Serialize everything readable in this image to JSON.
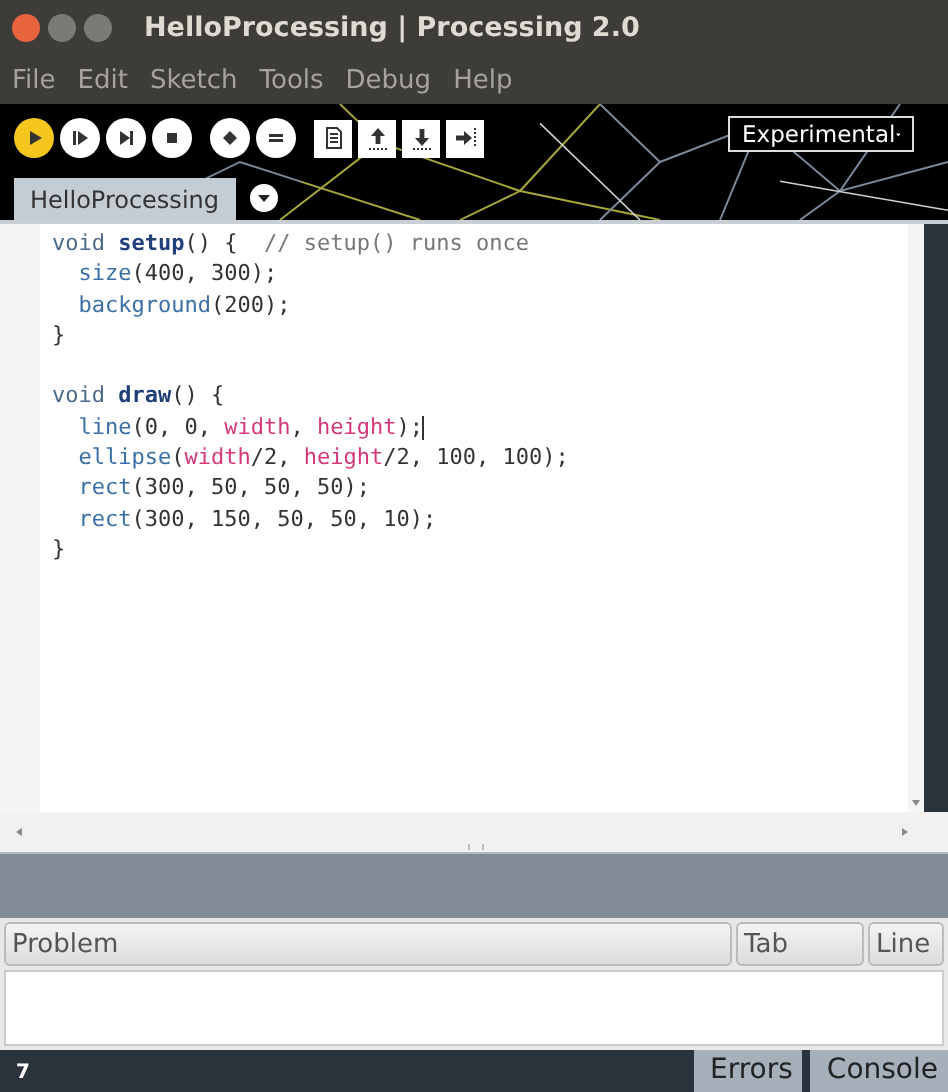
{
  "window": {
    "title": "HelloProcessing | Processing 2.0"
  },
  "menu": [
    "File",
    "Edit",
    "Sketch",
    "Tools",
    "Debug",
    "Help"
  ],
  "toolbar": [
    {
      "kind": "circle",
      "selected": true
    },
    {
      "kind": "circle",
      "selected": false
    },
    {
      "kind": "circle",
      "selected": false
    },
    {
      "kind": "circle",
      "selected": false
    },
    {
      "kind": "circle",
      "selected": false
    },
    {
      "kind": "circle",
      "selected": false
    },
    {
      "kind": "square",
      "selected": false
    },
    {
      "kind": "square",
      "selected": false
    },
    {
      "kind": "square",
      "selected": false
    },
    {
      "kind": "square",
      "selected": false
    }
  ],
  "mode": "Experimental",
  "tabs": [
    {
      "label": "HelloProcessing",
      "selected": true
    }
  ],
  "code": [
    {
      "lines": [
        {
          "cursor": false,
          "segments": [
            {
              "kind": "keyword",
              "t": "void "
            },
            {
              "kind": "function",
              "t": "setup"
            },
            {
              "kind": "plain",
              "t": "() {  "
            },
            {
              "kind": "comment",
              "t": "// setup() runs once"
            }
          ]
        },
        {
          "cursor": false,
          "segments": [
            {
              "kind": "call",
              "t": "  size"
            },
            {
              "kind": "plain",
              "t": "(400, 300);"
            }
          ]
        },
        {
          "cursor": false,
          "segments": [
            {
              "kind": "call",
              "t": "  background"
            },
            {
              "kind": "plain",
              "t": "(200);"
            }
          ]
        },
        {
          "cursor": false,
          "segments": [
            {
              "kind": "plain",
              "t": "}"
            }
          ]
        }
      ]
    },
    {
      "lines": [
        {
          "cursor": false,
          "segments": [
            {
              "kind": "keyword",
              "t": "void "
            },
            {
              "kind": "function",
              "t": "draw"
            },
            {
              "kind": "plain",
              "t": "() {"
            }
          ]
        },
        {
          "cursor": true,
          "segments": [
            {
              "kind": "call",
              "t": "  line"
            },
            {
              "kind": "plain",
              "t": "(0, 0, "
            },
            {
              "kind": "constant",
              "t": "width"
            },
            {
              "kind": "plain",
              "t": ", "
            },
            {
              "kind": "constant",
              "t": "height"
            },
            {
              "kind": "plain",
              "t": ");"
            }
          ]
        },
        {
          "cursor": false,
          "segments": [
            {
              "kind": "call",
              "t": "  ellipse"
            },
            {
              "kind": "plain",
              "t": "("
            },
            {
              "kind": "constant",
              "t": "width"
            },
            {
              "kind": "plain",
              "t": "/2, "
            },
            {
              "kind": "constant",
              "t": "height"
            },
            {
              "kind": "plain",
              "t": "/2, 100, 100);"
            }
          ]
        },
        {
          "cursor": false,
          "segments": [
            {
              "kind": "call",
              "t": "  rect"
            },
            {
              "kind": "plain",
              "t": "(300, 50, 50, 50);"
            }
          ]
        },
        {
          "cursor": false,
          "segments": [
            {
              "kind": "call",
              "t": "  rect"
            },
            {
              "kind": "plain",
              "t": "(300, 150, 50, 50, 10);"
            }
          ]
        },
        {
          "cursor": false,
          "segments": [
            {
              "kind": "plain",
              "t": "}"
            }
          ]
        }
      ]
    }
  ],
  "problems": {
    "columns": [
      "Problem",
      "Tab",
      "Line"
    ]
  },
  "status": {
    "line": "7",
    "tabs": [
      "Errors",
      "Console"
    ]
  }
}
